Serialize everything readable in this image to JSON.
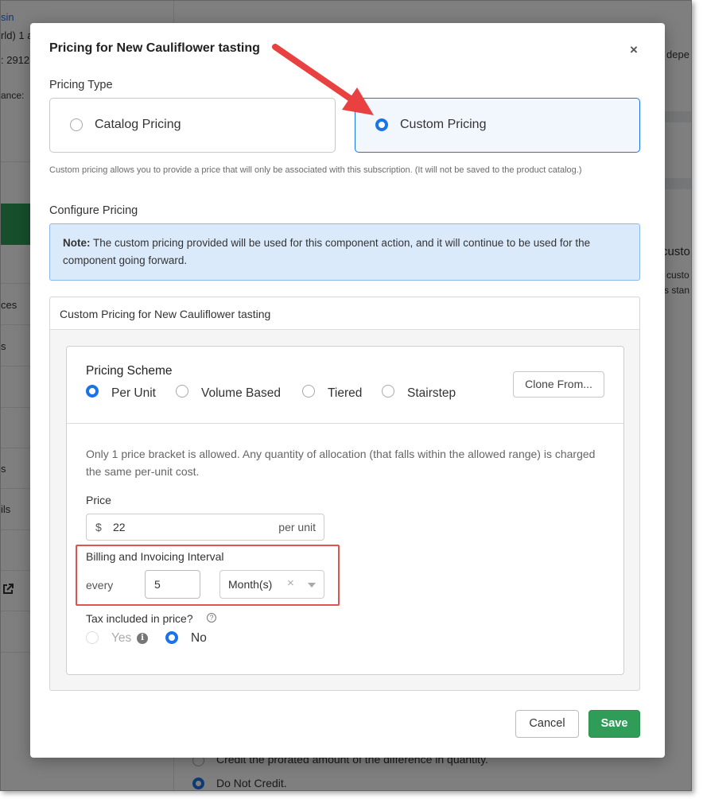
{
  "background": {
    "sidebar_fragments": [
      "sin",
      "rld) 1 a",
      ": 2912",
      "ance:",
      "ces",
      "s",
      "s",
      "ils"
    ],
    "right_fragments": [
      "depe",
      "custo",
      "custo",
      "s stan"
    ],
    "bottom_options": [
      "Credit the prorated amount of the difference in quantity.",
      "Do Not Credit."
    ]
  },
  "modal": {
    "title": "Pricing for New Cauliflower tasting",
    "close_label": "×",
    "pricing_type_label": "Pricing Type",
    "options": {
      "catalog": "Catalog Pricing",
      "custom": "Custom Pricing"
    },
    "helper_text": "Custom pricing allows you to provide a price that will only be associated with this subscription. (It will not be saved to the product catalog.)",
    "configure_label": "Configure Pricing",
    "note_bold": "Note:",
    "note_text": " The custom pricing provided will be used for this component action, and it will continue to be used for the component going forward.",
    "panel_title": "Custom Pricing for New Cauliflower tasting",
    "scheme": {
      "title": "Pricing Scheme",
      "options": [
        "Per Unit",
        "Volume Based",
        "Tiered",
        "Stairstep"
      ],
      "selected": "Per Unit",
      "clone_label": "Clone From..."
    },
    "description": "Only 1 price bracket is allowed. Any quantity of allocation (that falls within the allowed range) is charged the same per-unit cost.",
    "price": {
      "label": "Price",
      "currency": "$",
      "value": "22",
      "suffix": "per unit"
    },
    "interval": {
      "label": "Billing and Invoicing Interval",
      "prefix": "every",
      "value": "5",
      "unit": "Month(s)",
      "clear": "×"
    },
    "tax": {
      "label": "Tax included in price?",
      "help": "?",
      "yes": "Yes",
      "info": "i",
      "no": "No",
      "selected": "No"
    },
    "buttons": {
      "cancel": "Cancel",
      "save": "Save"
    }
  },
  "colors": {
    "accent": "#1a73e8",
    "save_green": "#2f9d57",
    "annotation_red": "#e8413f"
  }
}
